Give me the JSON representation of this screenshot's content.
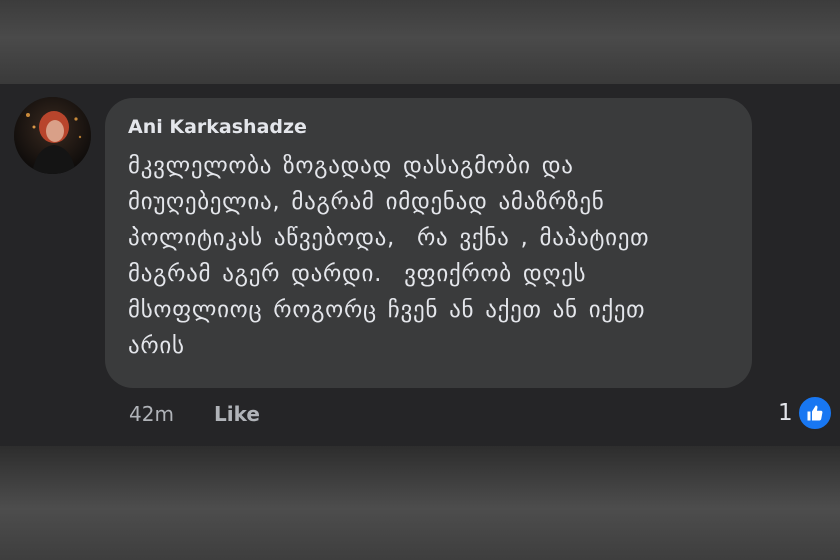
{
  "comment": {
    "author": "Ani Karkashadze",
    "text_lines": [
      "მკვლელობა ზოგადად დასაგმობი და",
      "მიუღებელია, მაგრამ იმდენად ამაზრზენ",
      "პოლიტიკას აწვებოდა,  რა ვქნა , მაპატიეთ",
      "მაგრამ აგერ დარდი.  ვფიქრობ დღეს",
      "მსოფლიოც როგორც ჩვენ ან აქეთ ან იქეთ",
      "არის"
    ],
    "timestamp": "42m",
    "like_label": "Like",
    "reaction_count": "1",
    "reaction_icon": "thumbs-up-icon"
  },
  "colors": {
    "panel": "#252527",
    "bubble": "#3a3b3c",
    "text": "#e4e6eb",
    "meta_text": "#b0b3b8",
    "like_blue": "#1877f2"
  }
}
